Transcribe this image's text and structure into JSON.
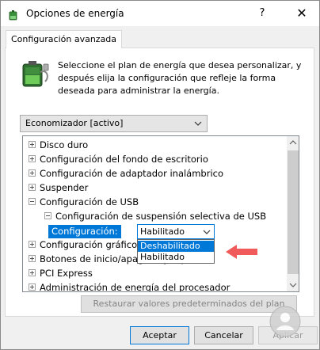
{
  "window": {
    "title": "Opciones de energía",
    "help_label": "?",
    "close_label": "✕"
  },
  "tab": {
    "label": "Configuración avanzada"
  },
  "description": "Seleccione el plan de energía que desea personalizar, y después elija la configuración que refleje la forma deseada para administrar la energía.",
  "plan_select": {
    "value": "Economizador [activo]"
  },
  "tree": {
    "items": [
      {
        "label": "Disco duro",
        "expander": "+"
      },
      {
        "label": "Configuración del fondo de escritorio",
        "expander": "+"
      },
      {
        "label": "Configuración de adaptador inalámbrico",
        "expander": "+"
      },
      {
        "label": "Suspender",
        "expander": "+"
      },
      {
        "label": "Configuración de USB",
        "expander": "-"
      },
      {
        "label": "Configuración de suspensión selectiva de USB",
        "expander": "-"
      },
      {
        "label": "Configuración gráficos",
        "expander": "+"
      },
      {
        "label": "Botones de inicio/apagado y tapa",
        "expander": "+"
      },
      {
        "label": "PCI Express",
        "expander": "+"
      },
      {
        "label": "Administración de energía del procesador",
        "expander": "+"
      }
    ]
  },
  "setting": {
    "label": "Configuración:",
    "value": "Habilitado",
    "options": [
      "Deshabilitado",
      "Habilitado"
    ],
    "highlighted": "Deshabilitado"
  },
  "buttons": {
    "restore": "Restaurar valores predeterminados del plan",
    "ok": "Aceptar",
    "cancel": "Cancelar",
    "apply": "Aplicar"
  },
  "colors": {
    "accent": "#0078d7",
    "arrow": "#f05a5a"
  }
}
